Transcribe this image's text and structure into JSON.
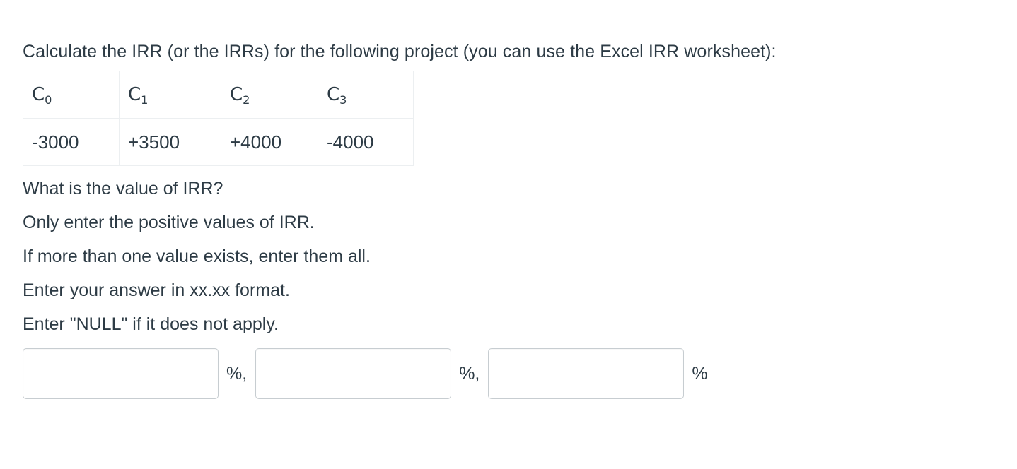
{
  "question": {
    "prompt": "Calculate the IRR (or the IRRs) for the following project (you can use the Excel IRR worksheet):"
  },
  "cash_flow_table": {
    "headers": [
      {
        "symbol": "C",
        "subscript": "0"
      },
      {
        "symbol": "C",
        "subscript": "1"
      },
      {
        "symbol": "C",
        "subscript": "2"
      },
      {
        "symbol": "C",
        "subscript": "3"
      }
    ],
    "values": [
      "-3000",
      "+3500",
      "+4000",
      "-4000"
    ]
  },
  "instructions": [
    "What is the value of IRR?",
    "Only enter the positive values of IRR.",
    "If more than one value exists, enter them all.",
    "Enter your answer in xx.xx format.",
    "Enter \"NULL\" if it does not apply."
  ],
  "answer_row": {
    "inputs": [
      {
        "value": "",
        "placeholder": "",
        "unit": "%,"
      },
      {
        "value": "",
        "placeholder": "",
        "unit": "%,"
      },
      {
        "value": "",
        "placeholder": "",
        "unit": "%"
      }
    ]
  },
  "colors": {
    "text": "#2d3b45",
    "table_border": "#eceff1",
    "input_border": "#c7cdd1",
    "background": "#ffffff"
  }
}
